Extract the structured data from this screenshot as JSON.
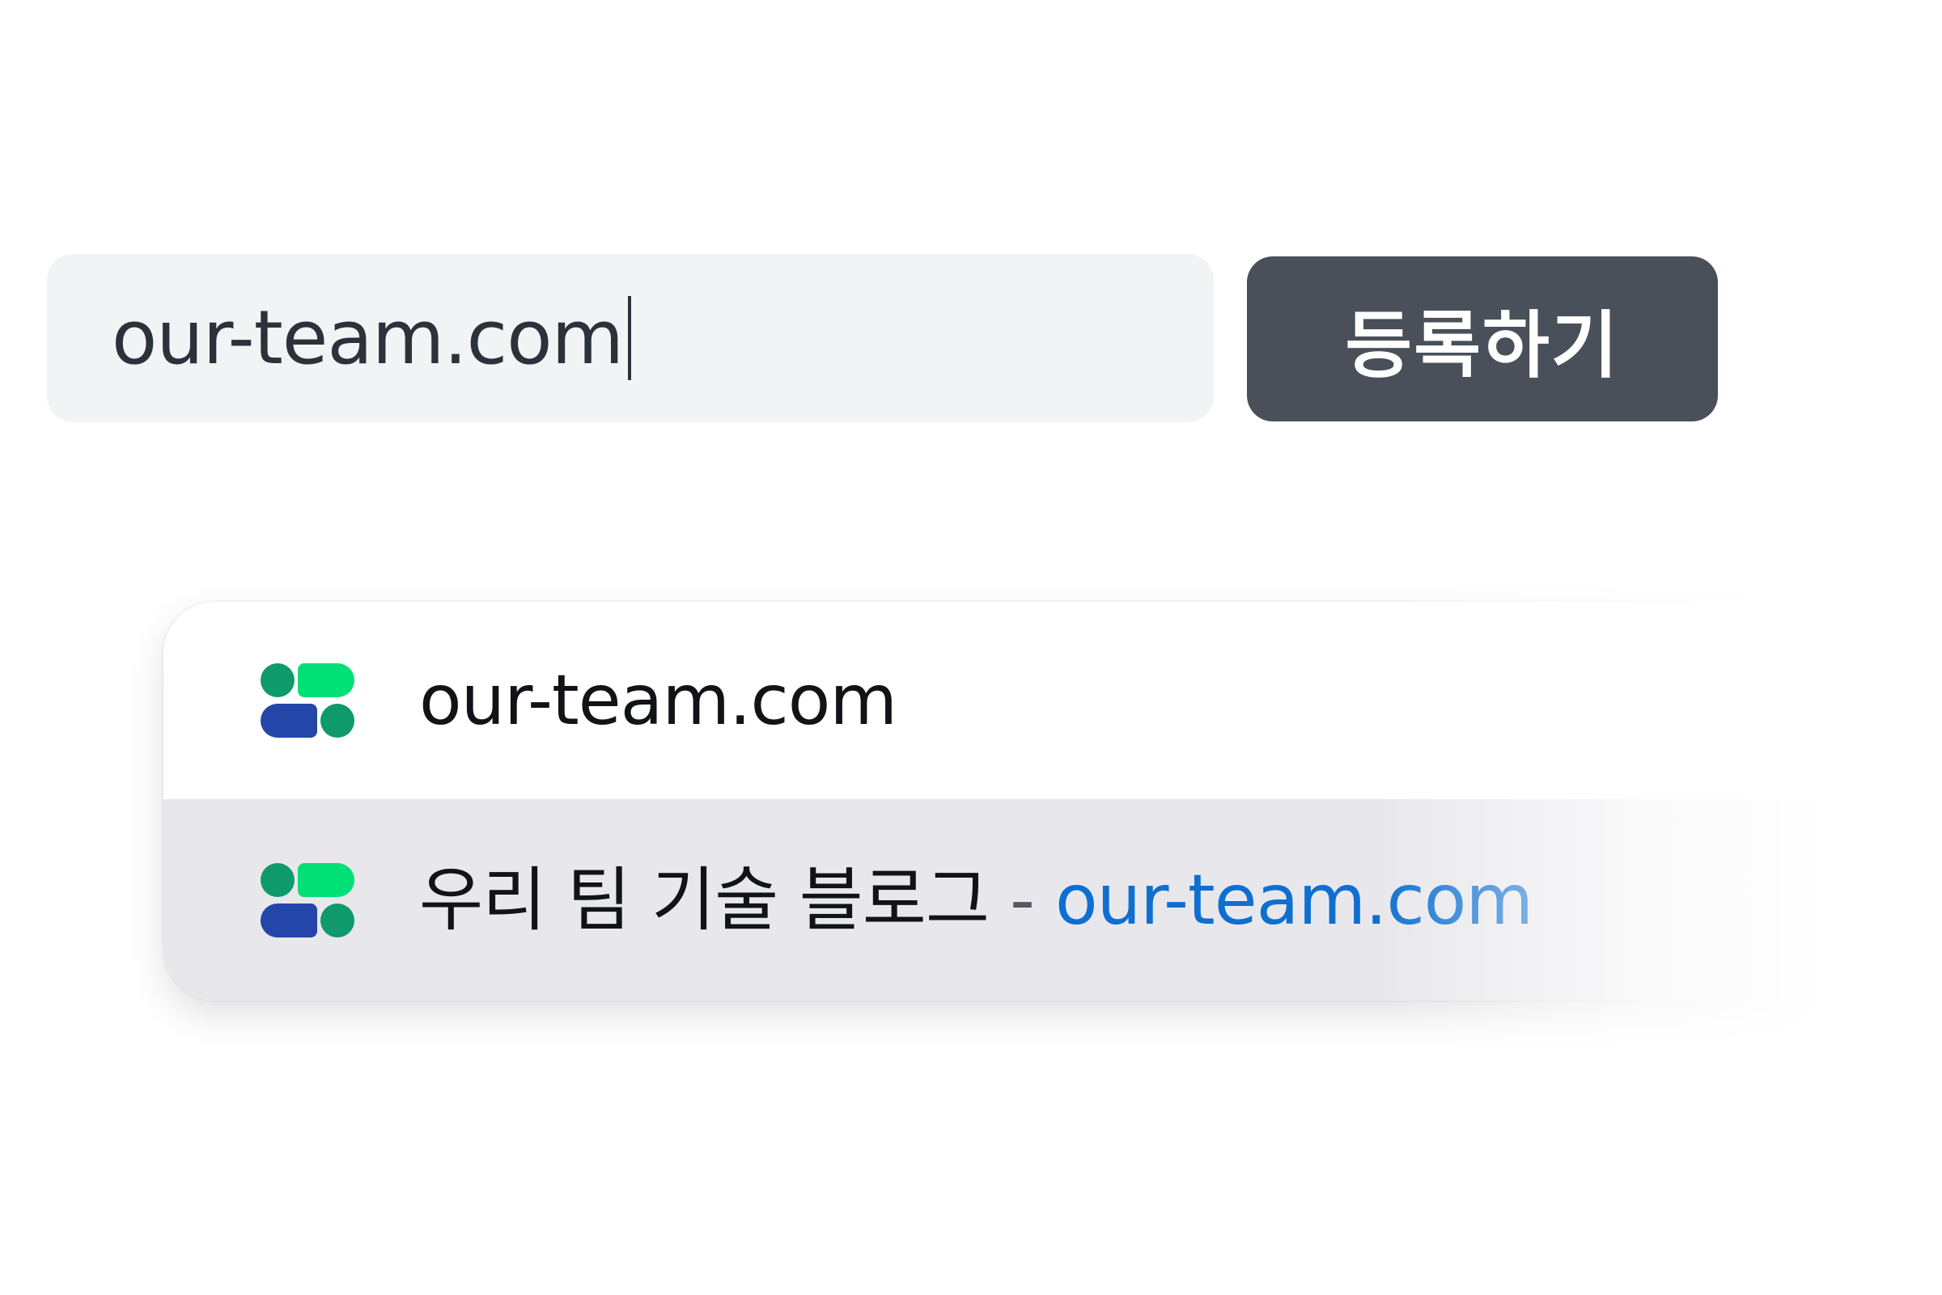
{
  "input": {
    "value": "our-team.com"
  },
  "register_button": {
    "label": "등록하기"
  },
  "suggestions": [
    {
      "label": "our-team.com",
      "icon": "brand-logo-icon"
    },
    {
      "title": "우리 팀 기술 블로그",
      "separator": "-",
      "domain": "our-team.com",
      "icon": "brand-logo-icon"
    }
  ],
  "colors": {
    "input_background": "#f2f3f5",
    "button_background": "#4a5059",
    "highlight_row": "#e8e8ec",
    "domain_link": "#0f6fd1",
    "logo_green_dark": "#0e9a6a",
    "logo_green_light": "#00e077",
    "logo_blue": "#2446a8"
  }
}
